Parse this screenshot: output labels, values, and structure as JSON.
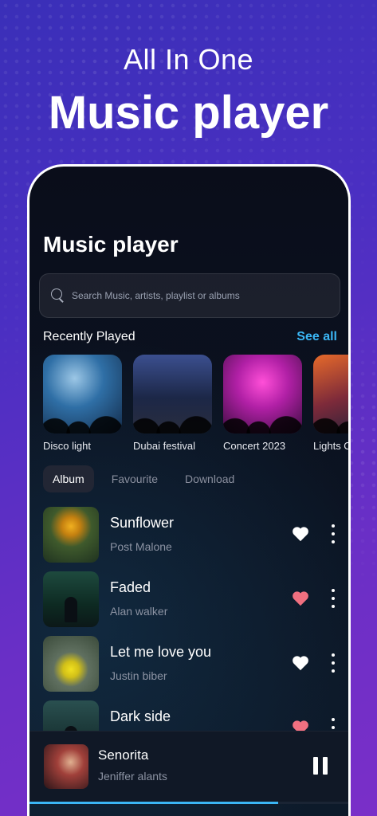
{
  "promo": {
    "line1": "All In One",
    "line2": "Music player"
  },
  "app": {
    "title": "Music player",
    "search": {
      "placeholder": "Search Music, artists, playlist or albums",
      "icon": "search-icon"
    }
  },
  "recent": {
    "title": "Recently Played",
    "see_all": "See all",
    "items": [
      {
        "label": "Disco light"
      },
      {
        "label": "Dubai festival"
      },
      {
        "label": "Concert 2023"
      },
      {
        "label": "Lights O"
      }
    ]
  },
  "tabs": [
    {
      "label": "Album",
      "active": true
    },
    {
      "label": "Favourite",
      "active": false
    },
    {
      "label": "Download",
      "active": false
    }
  ],
  "songs": [
    {
      "title": "Sunflower",
      "artist": "Post Malone",
      "liked": false
    },
    {
      "title": "Faded",
      "artist": "Alan walker",
      "liked": true
    },
    {
      "title": "Let me love you",
      "artist": "Justin biber",
      "liked": false
    },
    {
      "title": "Dark side",
      "artist": "",
      "liked": true
    }
  ],
  "now_playing": {
    "title": "Senorita",
    "artist": "Jeniffer alants",
    "progress": 0.78
  },
  "colors": {
    "accent": "#3bb6f5",
    "heart_liked": "#f07080",
    "heart_default": "#ffffff"
  }
}
